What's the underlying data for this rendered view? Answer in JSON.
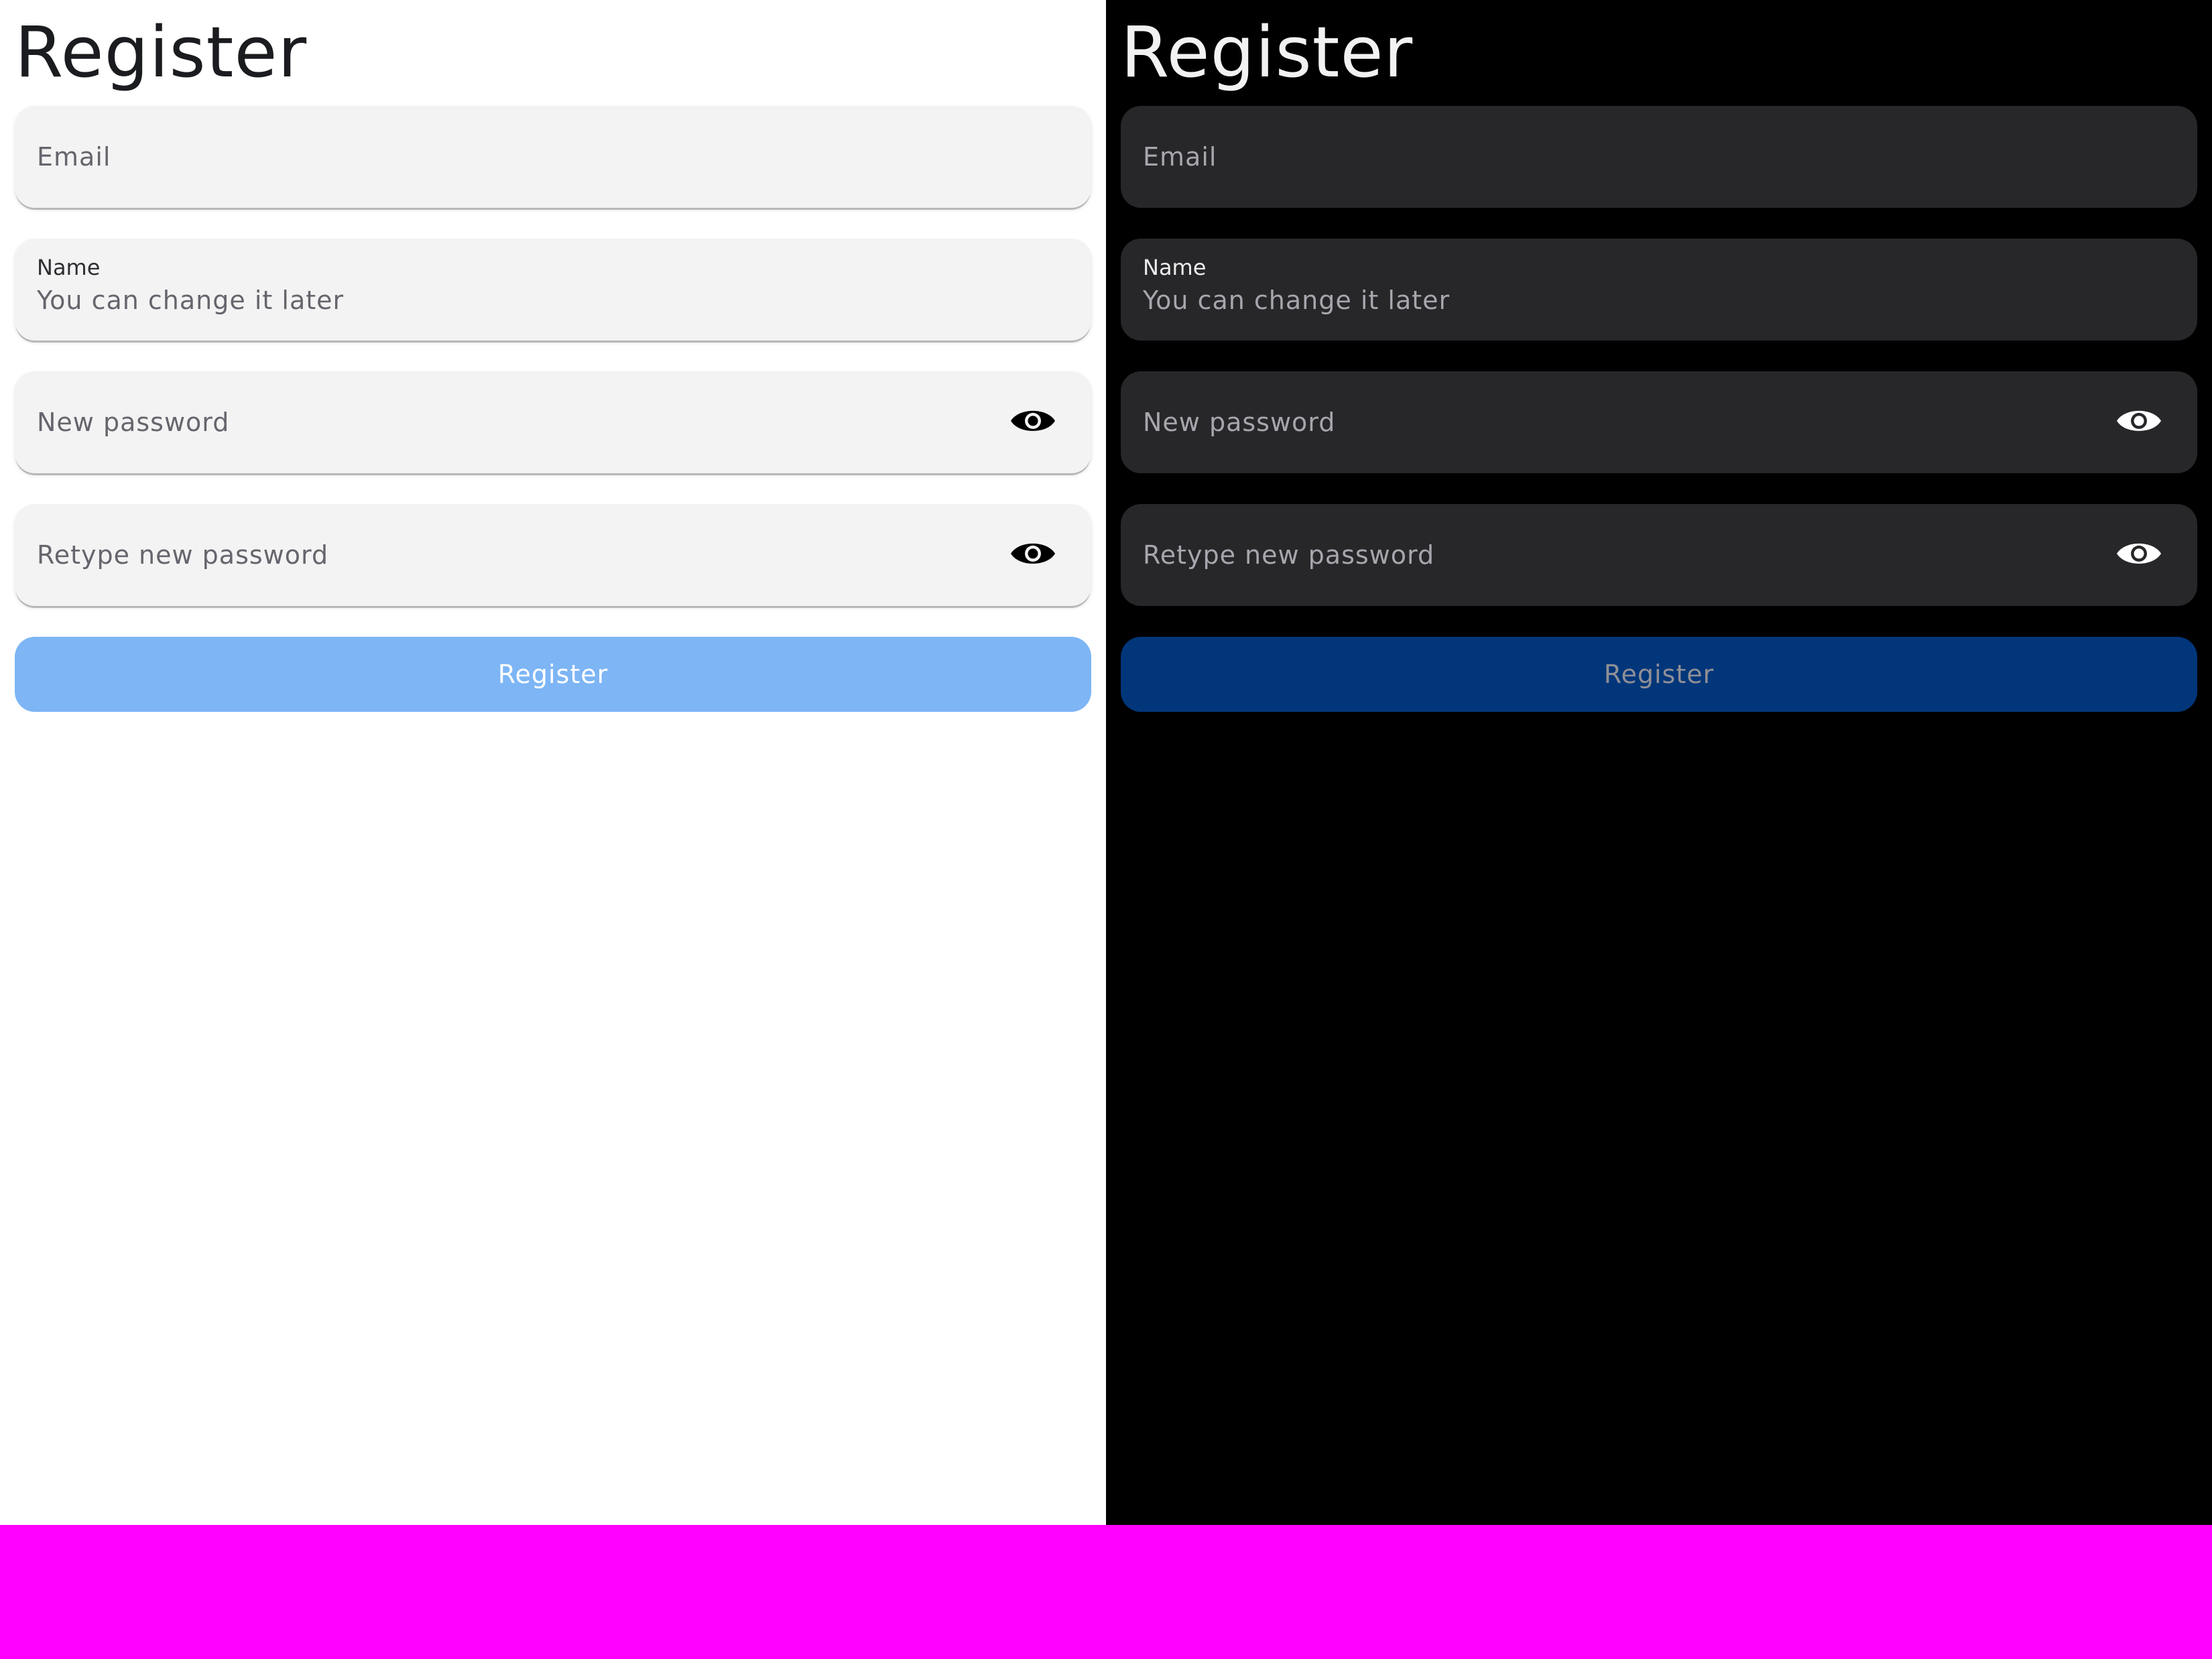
{
  "colors": {
    "light_background": "#ffffff",
    "dark_background": "#000000",
    "light_field": "#f3f3f3",
    "dark_field": "#27272a",
    "light_button": "#7db5f5",
    "dark_button": "#01367a",
    "bottom_bar": "#ff00ff"
  },
  "light": {
    "title": "Register",
    "email": {
      "placeholder": "Email"
    },
    "name": {
      "label": "Name",
      "placeholder": "You can change it later"
    },
    "new_password": {
      "placeholder": "New password",
      "icon": "eye-icon"
    },
    "retype_password": {
      "placeholder": "Retype new password",
      "icon": "eye-icon"
    },
    "register_button": "Register"
  },
  "dark": {
    "title": "Register",
    "email": {
      "placeholder": "Email"
    },
    "name": {
      "label": "Name",
      "placeholder": "You can change it later"
    },
    "new_password": {
      "placeholder": "New password",
      "icon": "eye-icon"
    },
    "retype_password": {
      "placeholder": "Retype new password",
      "icon": "eye-icon"
    },
    "register_button": "Register"
  }
}
